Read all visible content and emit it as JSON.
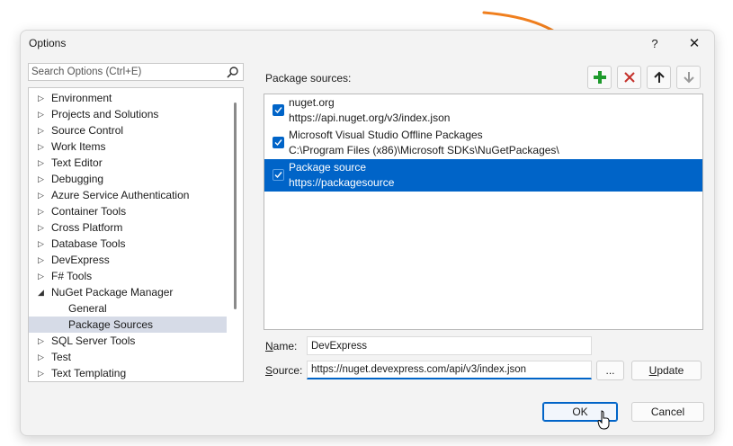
{
  "window": {
    "title": "Options",
    "help_label": "?",
    "close_label": "✕"
  },
  "search": {
    "placeholder": "Search Options (Ctrl+E)"
  },
  "tree": {
    "items": [
      {
        "label": "Environment",
        "expanded": false
      },
      {
        "label": "Projects and Solutions",
        "expanded": false
      },
      {
        "label": "Source Control",
        "expanded": false
      },
      {
        "label": "Work Items",
        "expanded": false
      },
      {
        "label": "Text Editor",
        "expanded": false
      },
      {
        "label": "Debugging",
        "expanded": false
      },
      {
        "label": "Azure Service Authentication",
        "expanded": false
      },
      {
        "label": "Container Tools",
        "expanded": false
      },
      {
        "label": "Cross Platform",
        "expanded": false
      },
      {
        "label": "Database Tools",
        "expanded": false
      },
      {
        "label": "DevExpress",
        "expanded": false
      },
      {
        "label": "F# Tools",
        "expanded": false
      },
      {
        "label": "NuGet Package Manager",
        "expanded": true
      },
      {
        "label": "General",
        "child": true
      },
      {
        "label": "Package Sources",
        "child": true,
        "selected": true
      },
      {
        "label": "SQL Server Tools",
        "expanded": false
      },
      {
        "label": "Test",
        "expanded": false
      },
      {
        "label": "Text Templating",
        "expanded": false
      }
    ]
  },
  "package_sources": {
    "label": "Package sources:",
    "sources": [
      {
        "name": "nuget.org",
        "url": "https://api.nuget.org/v3/index.json",
        "checked": true,
        "selected": false
      },
      {
        "name": "Microsoft Visual Studio Offline Packages",
        "url": "C:\\Program Files (x86)\\Microsoft SDKs\\NuGetPackages\\",
        "checked": true,
        "selected": false
      },
      {
        "name": "Package source",
        "url": "https://packagesource",
        "checked": true,
        "selected": true
      }
    ]
  },
  "form": {
    "name_label_u": "N",
    "name_label_rest": "ame:",
    "name_value": "DevExpress",
    "source_label_u": "S",
    "source_label_rest": "ource:",
    "source_value": "https://nuget.devexpress.com/api/v3/index.json",
    "browse_label": "...",
    "update_label_u": "U",
    "update_label_rest": "pdate"
  },
  "buttons": {
    "ok": "OK",
    "cancel": "Cancel"
  },
  "colors": {
    "accent": "#0064c8",
    "add_icon": "#1e9a2c",
    "remove_icon": "#c4312b",
    "annotation_arrow": "#f07f1e"
  },
  "icons": {
    "add": "plus-icon",
    "remove": "x-icon",
    "up": "arrow-up-icon",
    "down": "arrow-down-icon",
    "search": "search-icon"
  }
}
